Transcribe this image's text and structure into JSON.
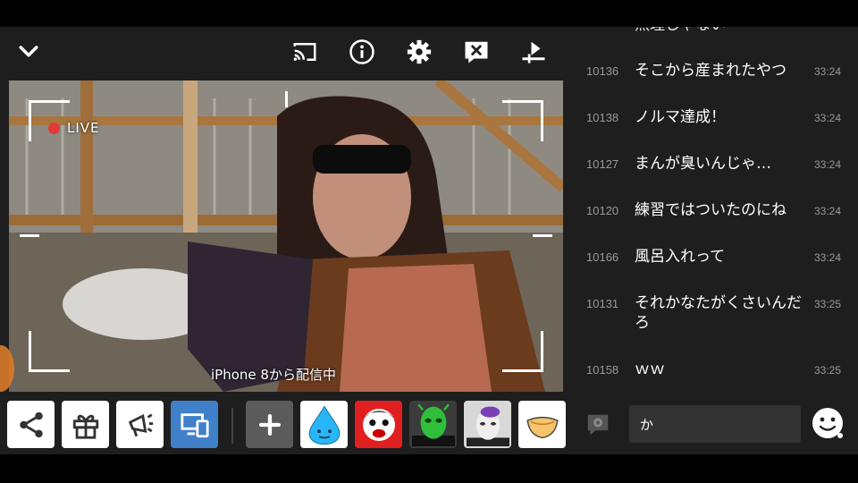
{
  "toolbar": {
    "icons": [
      "chevron-down-icon",
      "cast-icon",
      "info-icon",
      "gear-icon",
      "close-comment-icon",
      "playlist-icon"
    ]
  },
  "video": {
    "live_label": "LIVE",
    "device_label": "iPhone 8から配信中"
  },
  "comments": {
    "partial_top": "無理じゃない",
    "items": [
      {
        "num": "10136",
        "text": "そこから産まれたやつ",
        "time": "33:24"
      },
      {
        "num": "10138",
        "text": "ノルマ達成！",
        "time": "33:24"
      },
      {
        "num": "10127",
        "text": "まんが臭いんじゃ…",
        "time": "33:24"
      },
      {
        "num": "10120",
        "text": "練習ではついたのにね",
        "time": "33:24"
      },
      {
        "num": "10166",
        "text": "風呂入れって",
        "time": "33:24"
      },
      {
        "num": "10131",
        "text": "それかなたがくさいんだろ",
        "time": "33:25"
      },
      {
        "num": "10158",
        "text": "ｗｗ",
        "time": "33:25"
      }
    ]
  },
  "input": {
    "value": "か"
  },
  "colors": {
    "background": "#1e1e1e",
    "accent_blue": "#3f80c9",
    "live_red": "#e53935"
  }
}
